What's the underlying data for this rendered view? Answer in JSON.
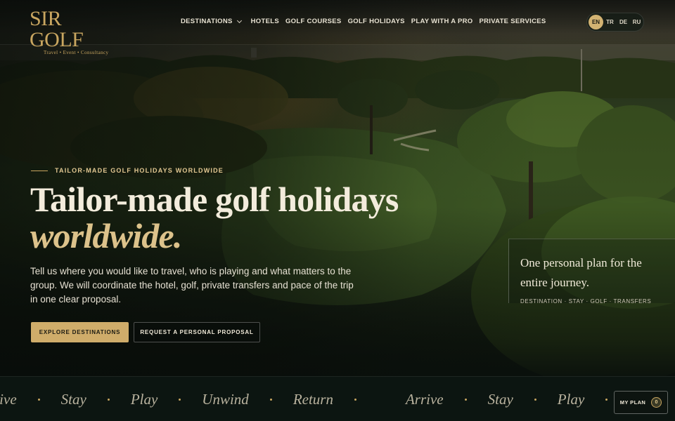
{
  "brand": {
    "logo_word": "SIR GOLF",
    "logo_tagline": "Travel • Event • Consultancy",
    "accent": "#cfac6a",
    "background": "#0c1511"
  },
  "nav": {
    "items": [
      {
        "label": "DESTINATIONS",
        "has_dropdown": true
      },
      {
        "label": "HOTELS"
      },
      {
        "label": "GOLF COURSES"
      },
      {
        "label": "GOLF HOLIDAYS"
      },
      {
        "label": "PLAY WITH A PRO"
      },
      {
        "label": "PRIVATE SERVICES"
      }
    ]
  },
  "languages": {
    "options": [
      "EN",
      "TR",
      "DE",
      "RU"
    ],
    "selected": "EN"
  },
  "hero": {
    "eyebrow": "TAILOR-MADE GOLF HOLIDAYS WORLDWIDE",
    "headline_line1": "Tailor-made golf holidays",
    "headline_line2": "worldwide.",
    "lede": "Tell us where you would like to travel, who is playing and what matters to the group. We will coordinate the hotel, golf, private transfers and pace of the trip in one clear proposal.",
    "primary_cta": "EXPLORE DESTINATIONS",
    "secondary_cta": "REQUEST A PERSONAL PROPOSAL"
  },
  "card": {
    "title": "One personal plan for the entire journey.",
    "meta": "DESTINATION · STAY · GOLF · TRANSFERS"
  },
  "ticker": {
    "words": [
      "Arrive",
      "Stay",
      "Play",
      "Unwind",
      "Return",
      "Arrive",
      "Stay",
      "Play"
    ]
  },
  "my_plan": {
    "label": "MY PLAN",
    "count": "0"
  }
}
